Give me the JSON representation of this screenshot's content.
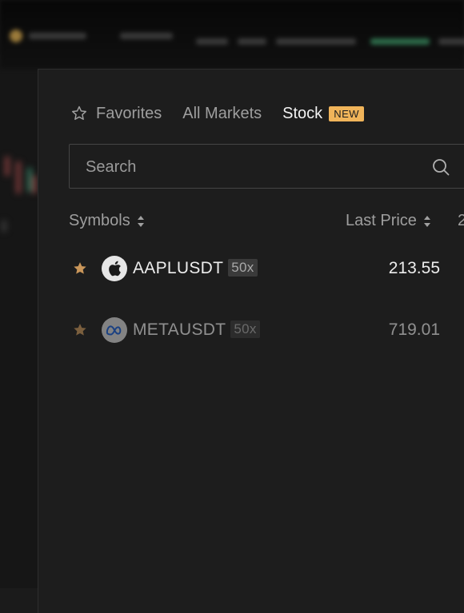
{
  "tabs": [
    {
      "label": "Favorites",
      "icon": "star-outline-icon"
    },
    {
      "label": "All Markets"
    },
    {
      "label": "Stock",
      "badge": "NEW",
      "active": true
    }
  ],
  "search": {
    "placeholder": "Search"
  },
  "columns": {
    "symbols": "Symbols",
    "last_price": "Last Price",
    "extra_header_fragment": "2"
  },
  "rows": [
    {
      "symbol": "AAPLUSDT",
      "leverage": "50x",
      "last_price": "213.55",
      "favorited": true,
      "logo": "apple-logo"
    },
    {
      "symbol": "METAUSDT",
      "leverage": "50x",
      "last_price": "719.01",
      "favorited": true,
      "logo": "meta-logo"
    }
  ],
  "colors": {
    "accent_badge": "#f0b45a",
    "star_filled": "#c9965a",
    "panel_bg": "#1d1d1d",
    "text_primary": "#f2f2f2",
    "text_secondary": "#9e9e9e"
  }
}
